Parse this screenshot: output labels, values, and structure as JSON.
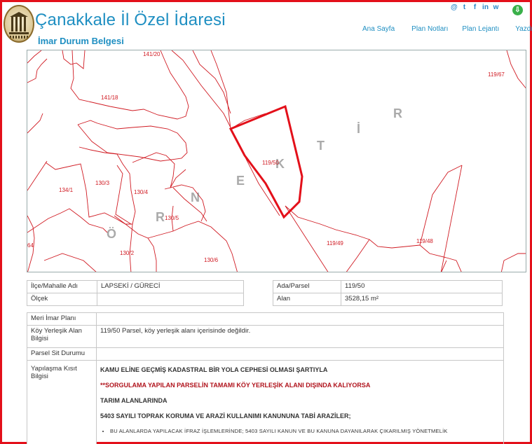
{
  "header": {
    "title": "Çanakkale İl Özel İdaresi",
    "subtitle": "İmar Durum Belgesi",
    "social_icons": [
      "at-icon",
      "twitter-icon",
      "facebook-icon",
      "linkedin-icon",
      "whatsapp-icon"
    ],
    "social_glyphs": [
      "@",
      "t",
      "f",
      "in",
      "w"
    ],
    "download_glyph": "⇩",
    "nav": [
      "Ana Sayfa",
      "Plan Notları",
      "Plan Lejantı",
      "Yazdır"
    ]
  },
  "map": {
    "highlighted_parcel": "119/50",
    "parcel_labels": [
      "141/20",
      "141/18",
      "119/67",
      "130/3",
      "130/4",
      "134/1",
      "130/5",
      "130/2",
      "130/6",
      "119/49",
      "119/48",
      "64"
    ],
    "watermark": [
      "Ö",
      "R",
      "N",
      "E",
      "K",
      "T",
      "İ",
      "R"
    ],
    "colors": {
      "parcel_line": "#d01a22",
      "highlight": "#e3101a"
    }
  },
  "location_table": {
    "rows": [
      {
        "label": "İlçe/Mahalle Adı",
        "value": "LAPSEKİ / GÜRECİ"
      },
      {
        "label": "Ölçek",
        "value": ""
      }
    ]
  },
  "parcel_table": {
    "rows": [
      {
        "label": "Ada/Parsel",
        "value": "119/50"
      },
      {
        "label": "Alan",
        "value": "3528,15 m²"
      }
    ]
  },
  "details_table": {
    "meri_label": "Meri İmar Planı",
    "meri_value": "",
    "koy_label": "Köy Yerleşik Alan Bilgisi",
    "koy_value": "119/50 Parsel, köy yerleşik alanı içerisinde değildir.",
    "sit_label": "Parsel Sit Durumu",
    "sit_value": "",
    "yap_label": "Yapılaşma Kısıt Bilgisi",
    "yap_lines": [
      "KAMU ELİNE GEÇMİŞ KADASTRAL BİR YOLA CEPHESİ OLMASI ŞARTIYLA",
      "**SORGULAMA YAPILAN PARSELİN TAMAMI KÖY YERLEŞİK ALANI DIŞINDA KALIYORSA",
      "TARIM ALANLARINDA",
      "5403 SAYILI TOPRAK KORUMA VE ARAZİ KULLANIMI KANUNUNA TABİ ARAZİLER;"
    ],
    "yap_bullet": "BU ALANLARDA YAPILACAK İFRAZ İŞLEMLERİNDE; 5403 SAYILI KANUN VE BU KANUNA DAYANILARAK ÇIKARILMIŞ YÖNETMELİK"
  }
}
